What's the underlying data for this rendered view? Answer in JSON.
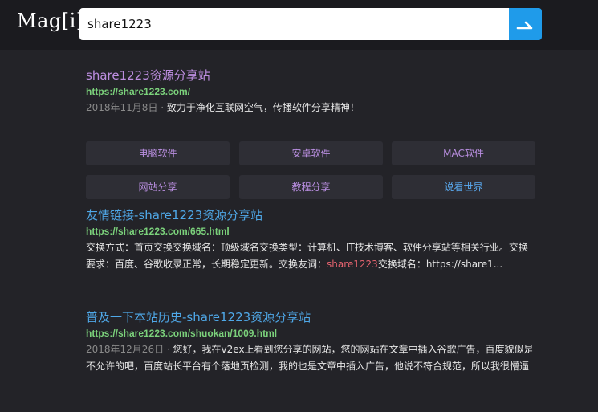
{
  "header": {
    "logo": "Mag[i]",
    "search_value": "share1223",
    "search_icon": "arrow-return-right-icon"
  },
  "results": [
    {
      "title": "share1223资源分享站",
      "url": "https://share1223.com/",
      "date": "2018年11月8日 ·",
      "snippet": "致力于净化互联网空气，传播软件分享精神！",
      "sublinks": [
        "电脑软件",
        "安卓软件",
        "MAC软件",
        "网站分享",
        "教程分享",
        "说看世界"
      ]
    },
    {
      "title": "友情链接-share1223资源分享站",
      "url": "https://share1223.com/665.html",
      "snippet_before": "交换方式：首页交换交换域名：顶级域名交换类型：计算机、IT技术博客、软件分享站等相关行业。交换要求：百度、谷歌收录正常，长期稳定更新。交换友词：",
      "snippet_highlight": "share1223",
      "snippet_after": "交换域名：https://share1..."
    },
    {
      "title": "普及一下本站历史-share1223资源分享站",
      "url": "https://share1223.com/shuokan/1009.html",
      "date": "2018年12月26日 ·",
      "snippet": "您好，我在v2ex上看到您分享的网站，您的网站在文章中插入谷歌广告，百度貌似是不允许的吧，百度站长平台有个落地页检测，我的也是文章中插入广告，他说不符合规范，所以我很懵逼"
    }
  ],
  "colors": {
    "background": "#232328",
    "topbar": "#1b1b1f",
    "accent": "#1f9bea",
    "visited_title": "#bd8ee0",
    "link_title": "#4fa8e8",
    "url": "#7bd17b",
    "highlight": "#e5636f"
  }
}
